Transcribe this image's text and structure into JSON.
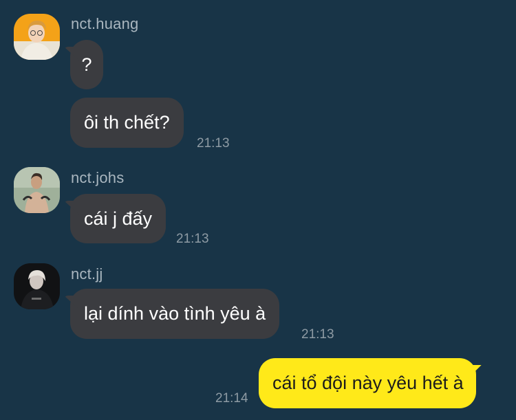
{
  "colors": {
    "background": "#183447",
    "incoming_bubble": "#3b3c40",
    "outgoing_bubble": "#ffe919",
    "sender_name": "#a9b6bf",
    "timestamp": "#8e9ba4"
  },
  "messages": [
    {
      "sender": "nct.huang",
      "avatar_icon": "profile-photo-orange-background",
      "bubbles": [
        "?",
        "ôi th chết?"
      ],
      "time": "21:13"
    },
    {
      "sender": "nct.johs",
      "avatar_icon": "profile-photo-green-background",
      "bubbles": [
        "cái j đấy"
      ],
      "time": "21:13"
    },
    {
      "sender": "nct.jj",
      "avatar_icon": "profile-photo-dark-background",
      "bubbles": [
        "lại dính vào tình yêu à"
      ],
      "time": "21:13"
    }
  ],
  "my_message": {
    "text": "cái tổ đội này yêu hết à",
    "time": "21:14"
  }
}
